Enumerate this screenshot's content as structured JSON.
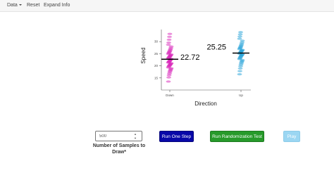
{
  "nav": {
    "data_label": "Data",
    "reset_label": "Reset",
    "expand_label": "Expand Info"
  },
  "chart_data": {
    "type": "scatter",
    "xlabel": "Direction",
    "ylabel": "Speed",
    "categories": [
      "Down",
      "Up"
    ],
    "ylim": [
      10,
      35
    ],
    "yticks": [
      15,
      20,
      25,
      30
    ],
    "groups": [
      {
        "category": "Down",
        "mean_label": "22.72",
        "mean": 22.72,
        "color": "#d81fb8",
        "values": [
          13.5,
          15.2,
          16.1,
          16.8,
          17.4,
          17.9,
          18.3,
          18.7,
          19.0,
          19.3,
          19.6,
          19.9,
          20.1,
          20.3,
          20.5,
          20.7,
          20.9,
          21.1,
          21.3,
          21.5,
          21.7,
          21.9,
          22.1,
          22.3,
          22.5,
          22.7,
          22.9,
          23.1,
          23.3,
          23.5,
          23.7,
          23.9,
          24.1,
          24.3,
          24.5,
          24.7,
          24.9,
          25.2,
          25.5,
          25.8,
          26.1,
          26.5,
          26.9,
          27.4,
          28.0,
          28.7,
          29.6,
          30.8,
          32.0,
          33.2
        ]
      },
      {
        "category": "Up",
        "mean_label": "25.25",
        "mean": 25.25,
        "color": "#1ea0d8",
        "values": [
          16.5,
          17.8,
          18.9,
          19.8,
          20.5,
          21.1,
          21.6,
          22.0,
          22.4,
          22.8,
          23.1,
          23.4,
          23.7,
          24.0,
          24.2,
          24.4,
          24.6,
          24.8,
          25.0,
          25.2,
          25.4,
          25.6,
          25.8,
          26.0,
          26.2,
          26.4,
          26.6,
          26.9,
          27.2,
          27.5,
          27.8,
          28.2,
          28.6,
          29.1,
          29.7,
          30.4,
          31.2,
          32.1,
          33.0,
          33.9
        ]
      }
    ]
  },
  "controls": {
    "sample_input": {
      "value": "500",
      "label": "Number of Samples to Draw*"
    },
    "run_one_step_label": "Run One Step",
    "run_randomization_label": "Run Randomization Test",
    "play_label": "Play"
  }
}
